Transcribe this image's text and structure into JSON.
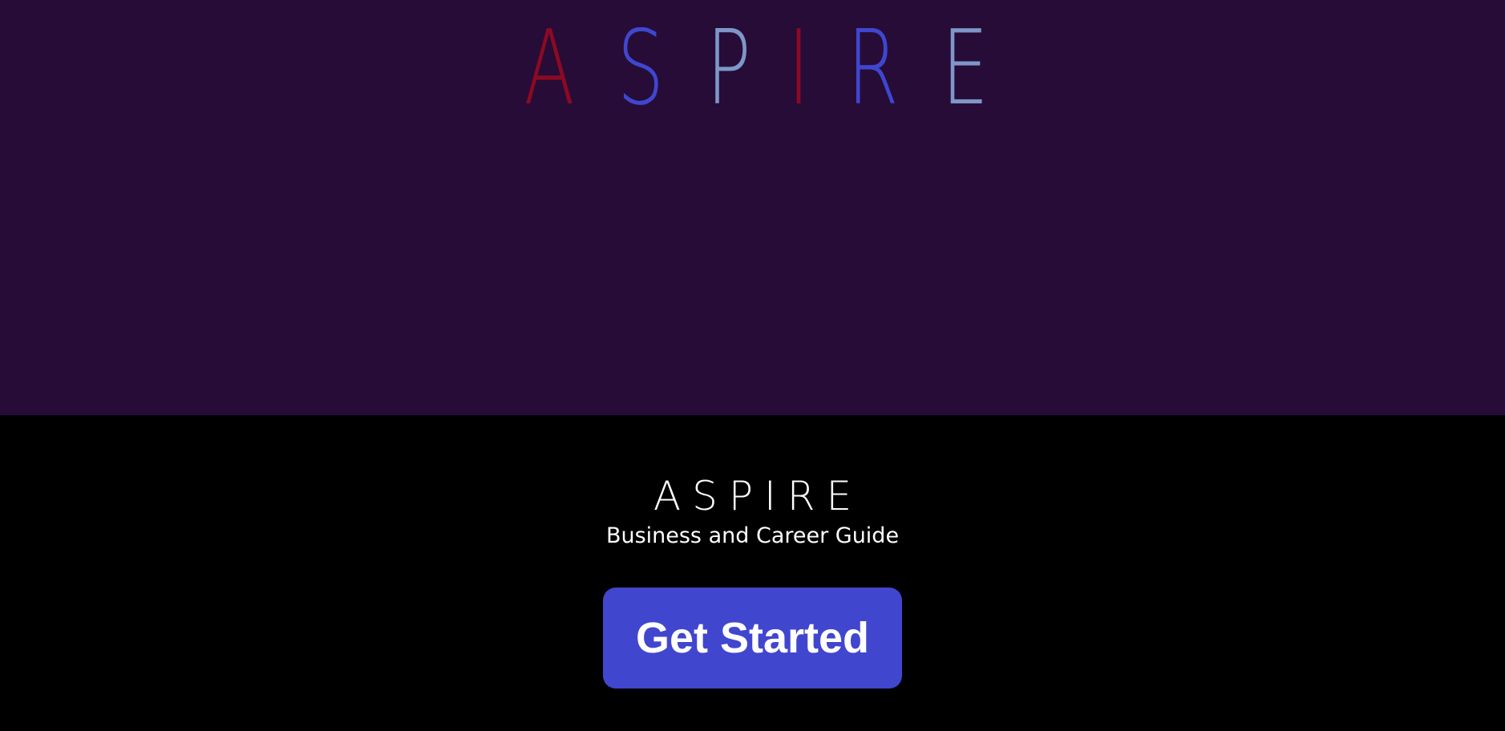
{
  "hero": {
    "background": "#270c37",
    "logo_letters": [
      {
        "char": "A",
        "color": "#8b0a22"
      },
      {
        "char": "S",
        "color": "#3f47d1"
      },
      {
        "char": "P",
        "color": "#7d97c8"
      },
      {
        "char": "I",
        "color": "#8b0a22"
      },
      {
        "char": "R",
        "color": "#3f47d1"
      },
      {
        "char": "E",
        "color": "#7d97c8"
      }
    ]
  },
  "footer": {
    "background": "#000000",
    "title": "ASPIRE",
    "tagline": "Business and Career Guide",
    "cta_label": "Get Started",
    "cta_color": "#4146cf"
  }
}
